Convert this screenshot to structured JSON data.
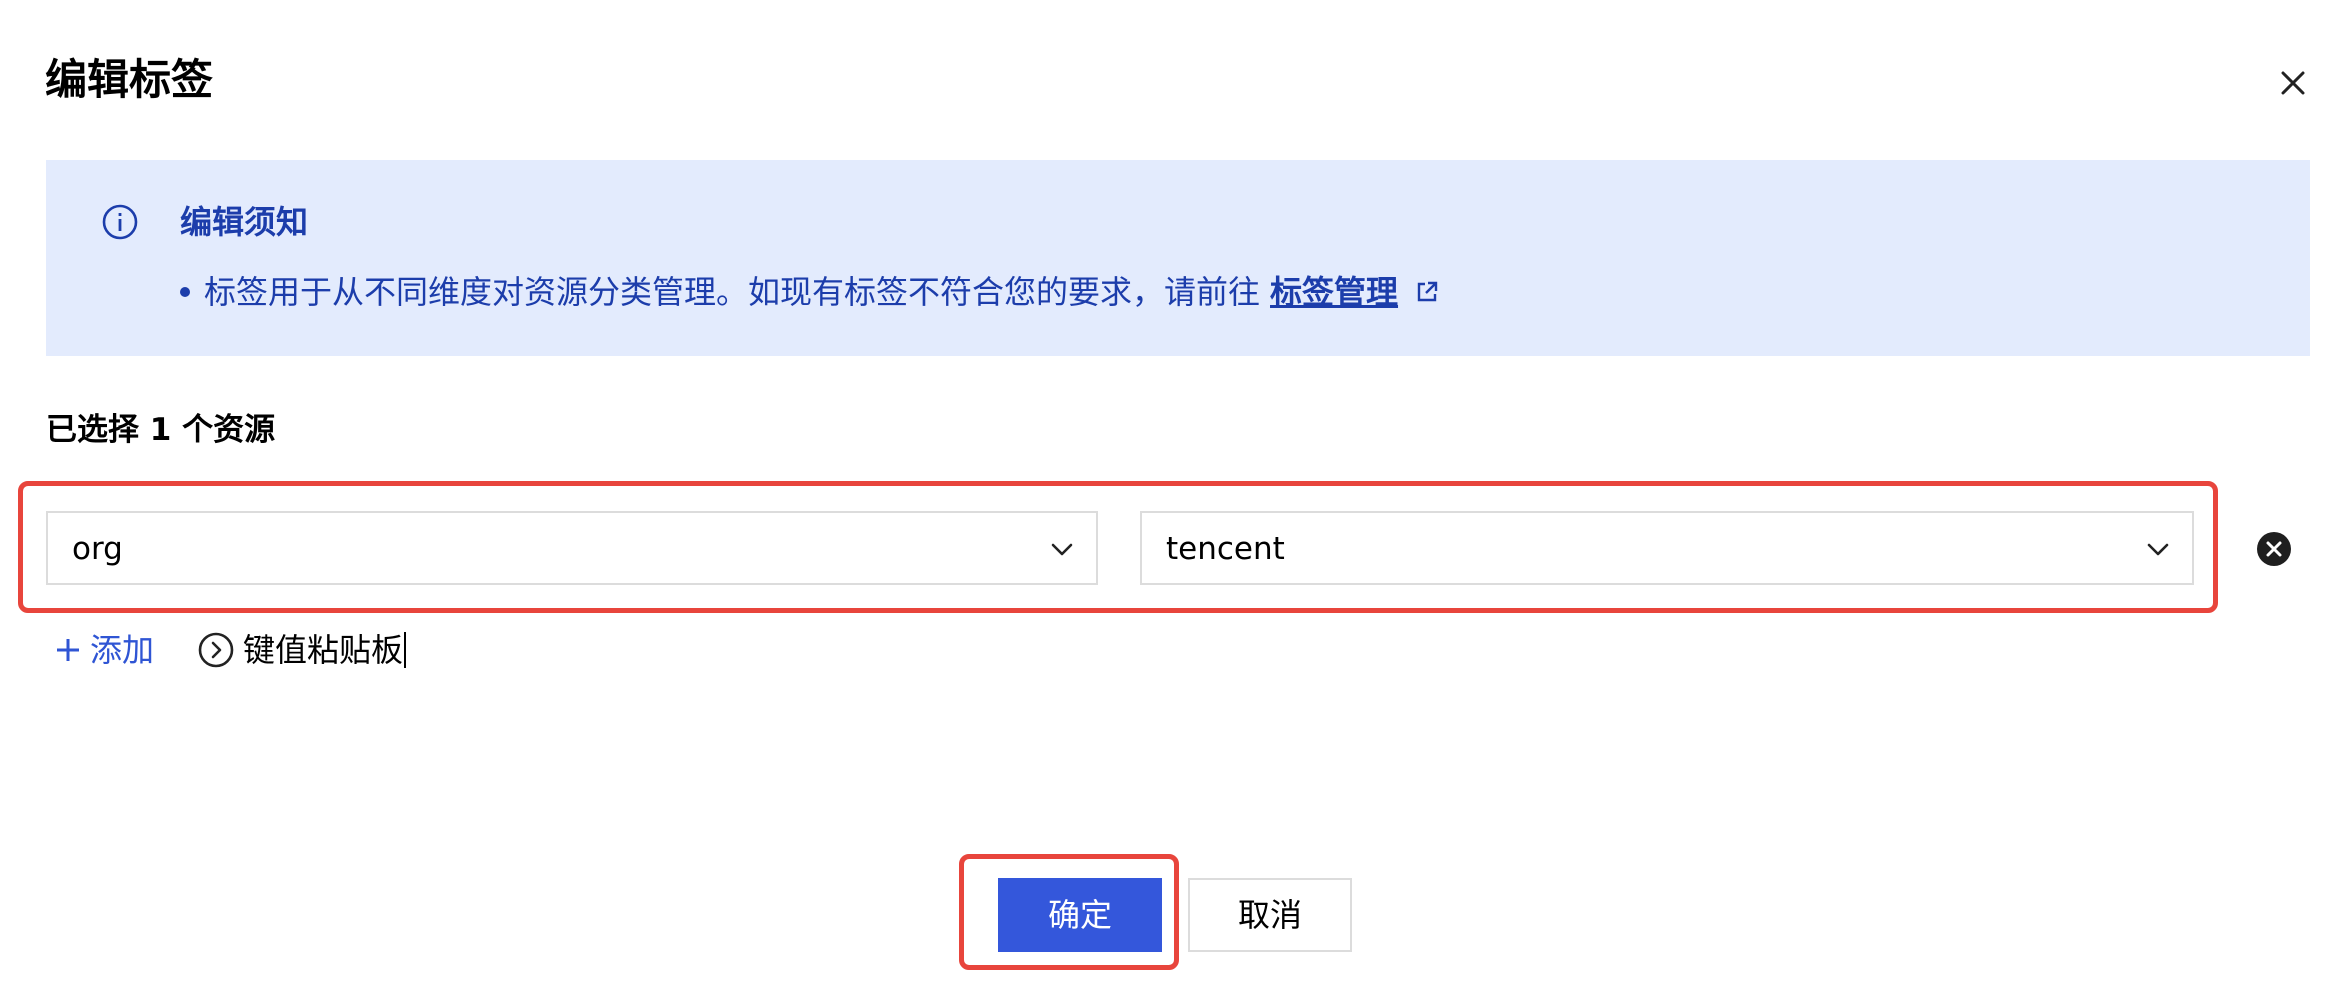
{
  "dialog": {
    "title": "编辑标签",
    "close_icon": "close-icon"
  },
  "notice": {
    "icon": "info-icon",
    "title": "编辑须知",
    "text": "标签用于从不同维度对资源分类管理。如现有标签不符合您的要求，请前往",
    "link_label": "标签管理",
    "link_icon": "external-link-icon"
  },
  "selection": {
    "label": "已选择 1 个资源"
  },
  "tag_row": {
    "key_value": "org",
    "value_value": "tencent",
    "remove_icon": "close-circle-icon"
  },
  "actions": {
    "add_label": "添加",
    "paste_label": "键值粘贴板"
  },
  "footer": {
    "ok_label": "确定",
    "cancel_label": "取消"
  },
  "colors": {
    "primary": "#3457db",
    "notice_bg": "#e3ebfd",
    "notice_text": "#1c3dab",
    "highlight": "#e8453c"
  }
}
